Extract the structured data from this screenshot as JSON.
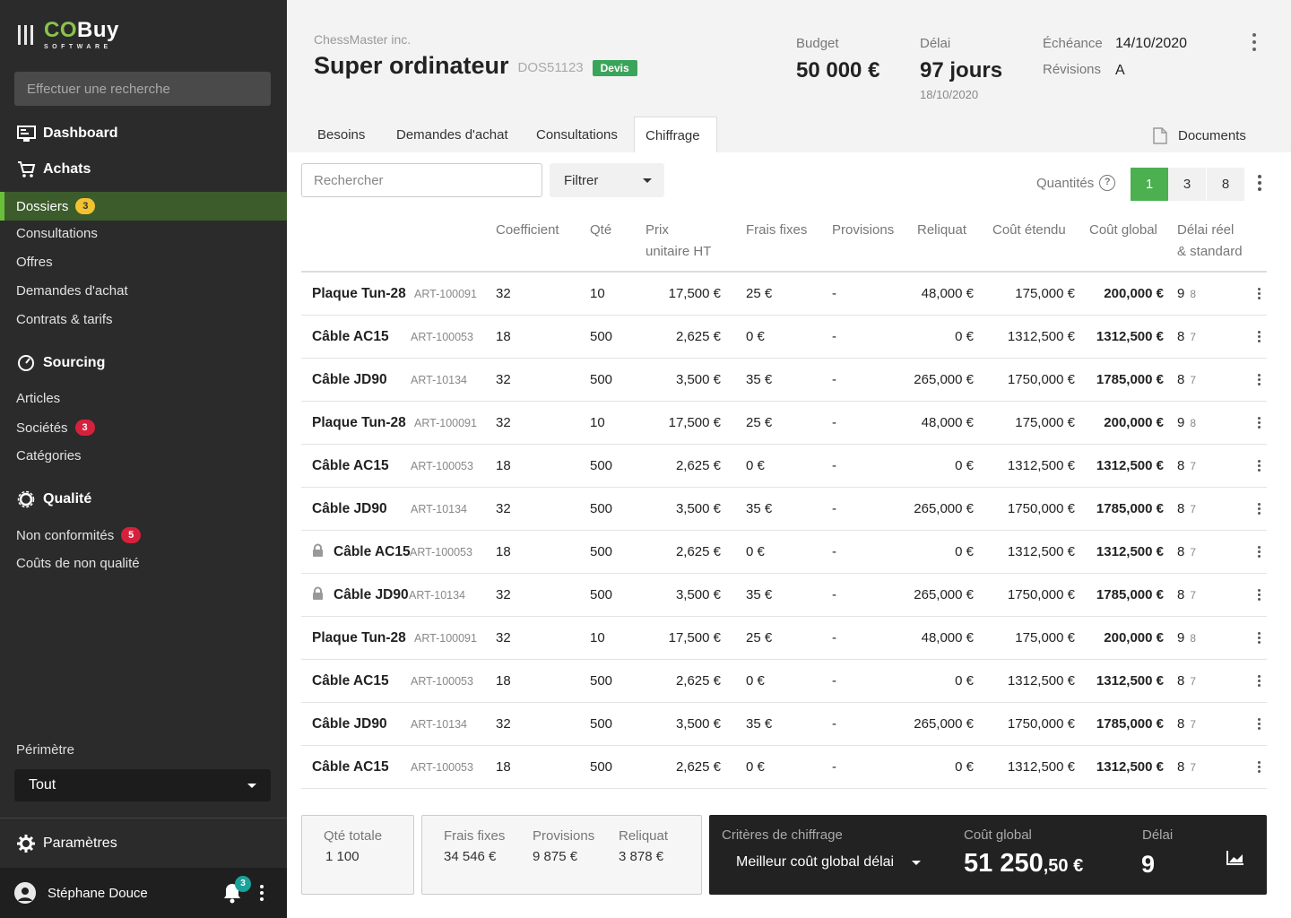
{
  "brand": {
    "name_co": "CO",
    "name_rest": "Buy",
    "sub": "SOFTWARE"
  },
  "sidebar": {
    "search_placeholder": "Effectuer une recherche",
    "dashboard": "Dashboard",
    "achats": "Achats",
    "dossiers": "Dossiers",
    "dossiers_badge": "3",
    "consultations": "Consultations",
    "offres": "Offres",
    "demandes": "Demandes d'achat",
    "contrats": "Contrats & tarifs",
    "sourcing": "Sourcing",
    "articles": "Articles",
    "societes": "Sociétés",
    "societes_badge": "3",
    "categories": "Catégories",
    "qualite": "Qualité",
    "non_conformites": "Non conformités",
    "non_conformites_badge": "5",
    "couts_nq": "Coûts de non qualité",
    "perimetre_label": "Périmètre",
    "perimetre_value": "Tout",
    "parametres": "Paramètres",
    "user_name": "Stéphane Douce",
    "notif_count": "3"
  },
  "header": {
    "client": "ChessMaster inc.",
    "title": "Super ordinateur",
    "dossier_id": "DOS51123",
    "status": "Devis",
    "budget_label": "Budget",
    "budget_value": "50 000 €",
    "delai_label": "Délai",
    "delai_value": "97 jours",
    "delai_date": "18/10/2020",
    "echeance_label": "Échéance",
    "echeance_value": "14/10/2020",
    "revisions_label": "Révisions",
    "revisions_value": "A"
  },
  "tabs": [
    "Besoins",
    "Demandes d'achat",
    "Consultations",
    "Chiffrage"
  ],
  "documents_label": "Documents",
  "toolbar": {
    "search_placeholder": "Rechercher",
    "filter_label": "Filtrer",
    "quantities_label": "Quantités",
    "help": "?",
    "quantities": [
      "1",
      "3",
      "8"
    ]
  },
  "table": {
    "headers": {
      "coef": "Coefficient",
      "qte": "Qté",
      "prix1": "Prix",
      "prix2": "unitaire HT",
      "frais": "Frais fixes",
      "prov": "Provisions",
      "reliquat": "Reliquat",
      "cout_etendu": "Coût étendu",
      "cout_global": "Coût global",
      "delai1": "Délai réel",
      "delai2": "& standard"
    },
    "rows": [
      {
        "name": "Plaque Tun-28",
        "ref": "ART-100091",
        "coef": "32",
        "qte": "10",
        "prix": "17,500 €",
        "frais": "25 €",
        "prov": "-",
        "reliquat": "48,000 €",
        "etendu": "175,000 €",
        "global": "200,000 €",
        "delai": "9",
        "std": "8",
        "locked": false
      },
      {
        "name": "Câble AC15",
        "ref": "ART-100053",
        "coef": "18",
        "qte": "500",
        "prix": "2,625 €",
        "frais": "0 €",
        "prov": "-",
        "reliquat": "0 €",
        "etendu": "1312,500 €",
        "global": "1312,500 €",
        "delai": "8",
        "std": "7",
        "locked": false
      },
      {
        "name": "Câble JD90",
        "ref": "ART-10134",
        "coef": "32",
        "qte": "500",
        "prix": "3,500 €",
        "frais": "35 €",
        "prov": "-",
        "reliquat": "265,000 €",
        "etendu": "1750,000 €",
        "global": "1785,000 €",
        "delai": "8",
        "std": "7",
        "locked": false
      },
      {
        "name": "Plaque Tun-28",
        "ref": "ART-100091",
        "coef": "32",
        "qte": "10",
        "prix": "17,500 €",
        "frais": "25 €",
        "prov": "-",
        "reliquat": "48,000 €",
        "etendu": "175,000 €",
        "global": "200,000 €",
        "delai": "9",
        "std": "8",
        "locked": false
      },
      {
        "name": "Câble AC15",
        "ref": "ART-100053",
        "coef": "18",
        "qte": "500",
        "prix": "2,625 €",
        "frais": "0 €",
        "prov": "-",
        "reliquat": "0 €",
        "etendu": "1312,500 €",
        "global": "1312,500 €",
        "delai": "8",
        "std": "7",
        "locked": false
      },
      {
        "name": "Câble JD90",
        "ref": "ART-10134",
        "coef": "32",
        "qte": "500",
        "prix": "3,500 €",
        "frais": "35 €",
        "prov": "-",
        "reliquat": "265,000 €",
        "etendu": "1750,000 €",
        "global": "1785,000 €",
        "delai": "8",
        "std": "7",
        "locked": false
      },
      {
        "name": "Câble AC15",
        "ref": "ART-100053",
        "coef": "18",
        "qte": "500",
        "prix": "2,625 €",
        "frais": "0 €",
        "prov": "-",
        "reliquat": "0 €",
        "etendu": "1312,500 €",
        "global": "1312,500 €",
        "delai": "8",
        "std": "7",
        "locked": true
      },
      {
        "name": "Câble JD90",
        "ref": "ART-10134",
        "coef": "32",
        "qte": "500",
        "prix": "3,500 €",
        "frais": "35 €",
        "prov": "-",
        "reliquat": "265,000 €",
        "etendu": "1750,000 €",
        "global": "1785,000 €",
        "delai": "8",
        "std": "7",
        "locked": true
      },
      {
        "name": "Plaque Tun-28",
        "ref": "ART-100091",
        "coef": "32",
        "qte": "10",
        "prix": "17,500 €",
        "frais": "25 €",
        "prov": "-",
        "reliquat": "48,000 €",
        "etendu": "175,000 €",
        "global": "200,000 €",
        "delai": "9",
        "std": "8",
        "locked": false
      },
      {
        "name": "Câble AC15",
        "ref": "ART-100053",
        "coef": "18",
        "qte": "500",
        "prix": "2,625 €",
        "frais": "0 €",
        "prov": "-",
        "reliquat": "0 €",
        "etendu": "1312,500 €",
        "global": "1312,500 €",
        "delai": "8",
        "std": "7",
        "locked": false
      },
      {
        "name": "Câble JD90",
        "ref": "ART-10134",
        "coef": "32",
        "qte": "500",
        "prix": "3,500 €",
        "frais": "35 €",
        "prov": "-",
        "reliquat": "265,000 €",
        "etendu": "1750,000 €",
        "global": "1785,000 €",
        "delai": "8",
        "std": "7",
        "locked": false
      },
      {
        "name": "Câble AC15",
        "ref": "ART-100053",
        "coef": "18",
        "qte": "500",
        "prix": "2,625 €",
        "frais": "0 €",
        "prov": "-",
        "reliquat": "0 €",
        "etendu": "1312,500 €",
        "global": "1312,500 €",
        "delai": "8",
        "std": "7",
        "locked": false
      }
    ]
  },
  "footer": {
    "qte_totale_label": "Qté totale",
    "qte_totale_value": "1 100",
    "frais_label": "Frais fixes",
    "frais_value": "34 546 €",
    "provisions_label": "Provisions",
    "provisions_value": "9 875 €",
    "reliquat_label": "Reliquat",
    "reliquat_value": "3 878 €",
    "criteres_label": "Critères de chiffrage",
    "criteres_value": "Meilleur coût global délai",
    "cout_global_label": "Coût global",
    "cout_global_int": "51 250",
    "cout_global_dec": ",50 €",
    "delai_label": "Délai",
    "delai_value": "9"
  },
  "colors": {
    "accent_green": "#4caf50",
    "sidebar_bg": "#2b2b2b",
    "badge_red": "#d6213c",
    "badge_yellow": "#f2c230"
  }
}
